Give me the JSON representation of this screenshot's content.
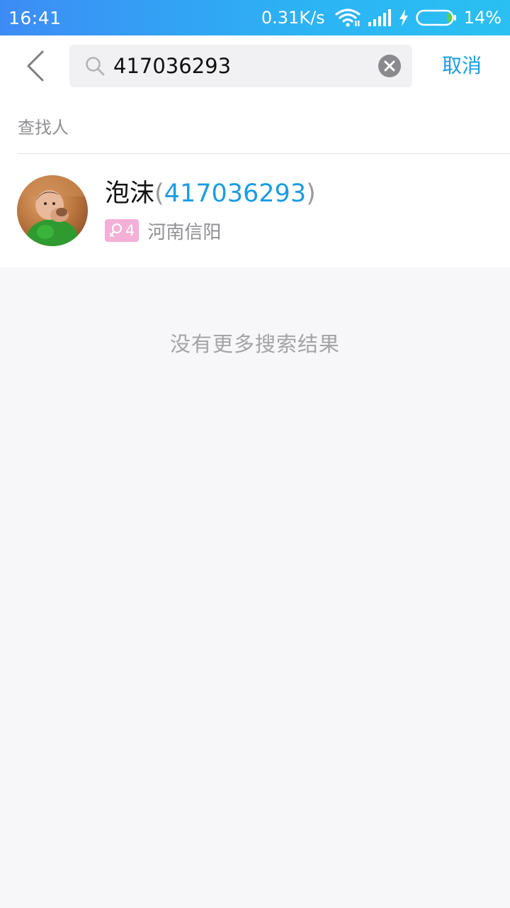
{
  "status_bar": {
    "time": "16:41",
    "net_speed": "0.31K/s",
    "battery_percent": "14%",
    "battery_level": 0.14,
    "icons": [
      "wifi-icon",
      "signal-icon",
      "charging-icon",
      "battery-icon"
    ]
  },
  "search": {
    "query": "417036293",
    "cancel_label": "取消"
  },
  "section": {
    "label": "查找人"
  },
  "results": [
    {
      "name": "泡沫",
      "paren_open": "(",
      "account_id": "417036293",
      "paren_close": ")",
      "gender_icon": "female-icon",
      "age": "4",
      "location": "河南信阳"
    }
  ],
  "footer_message": "没有更多搜索结果",
  "colors": {
    "accent": "#1a9de1",
    "status_bar_start": "#3d8cf5",
    "status_bar_end": "#2ac0f2",
    "female_badge": "#f4b0d7",
    "background": "#f7f7f9"
  }
}
